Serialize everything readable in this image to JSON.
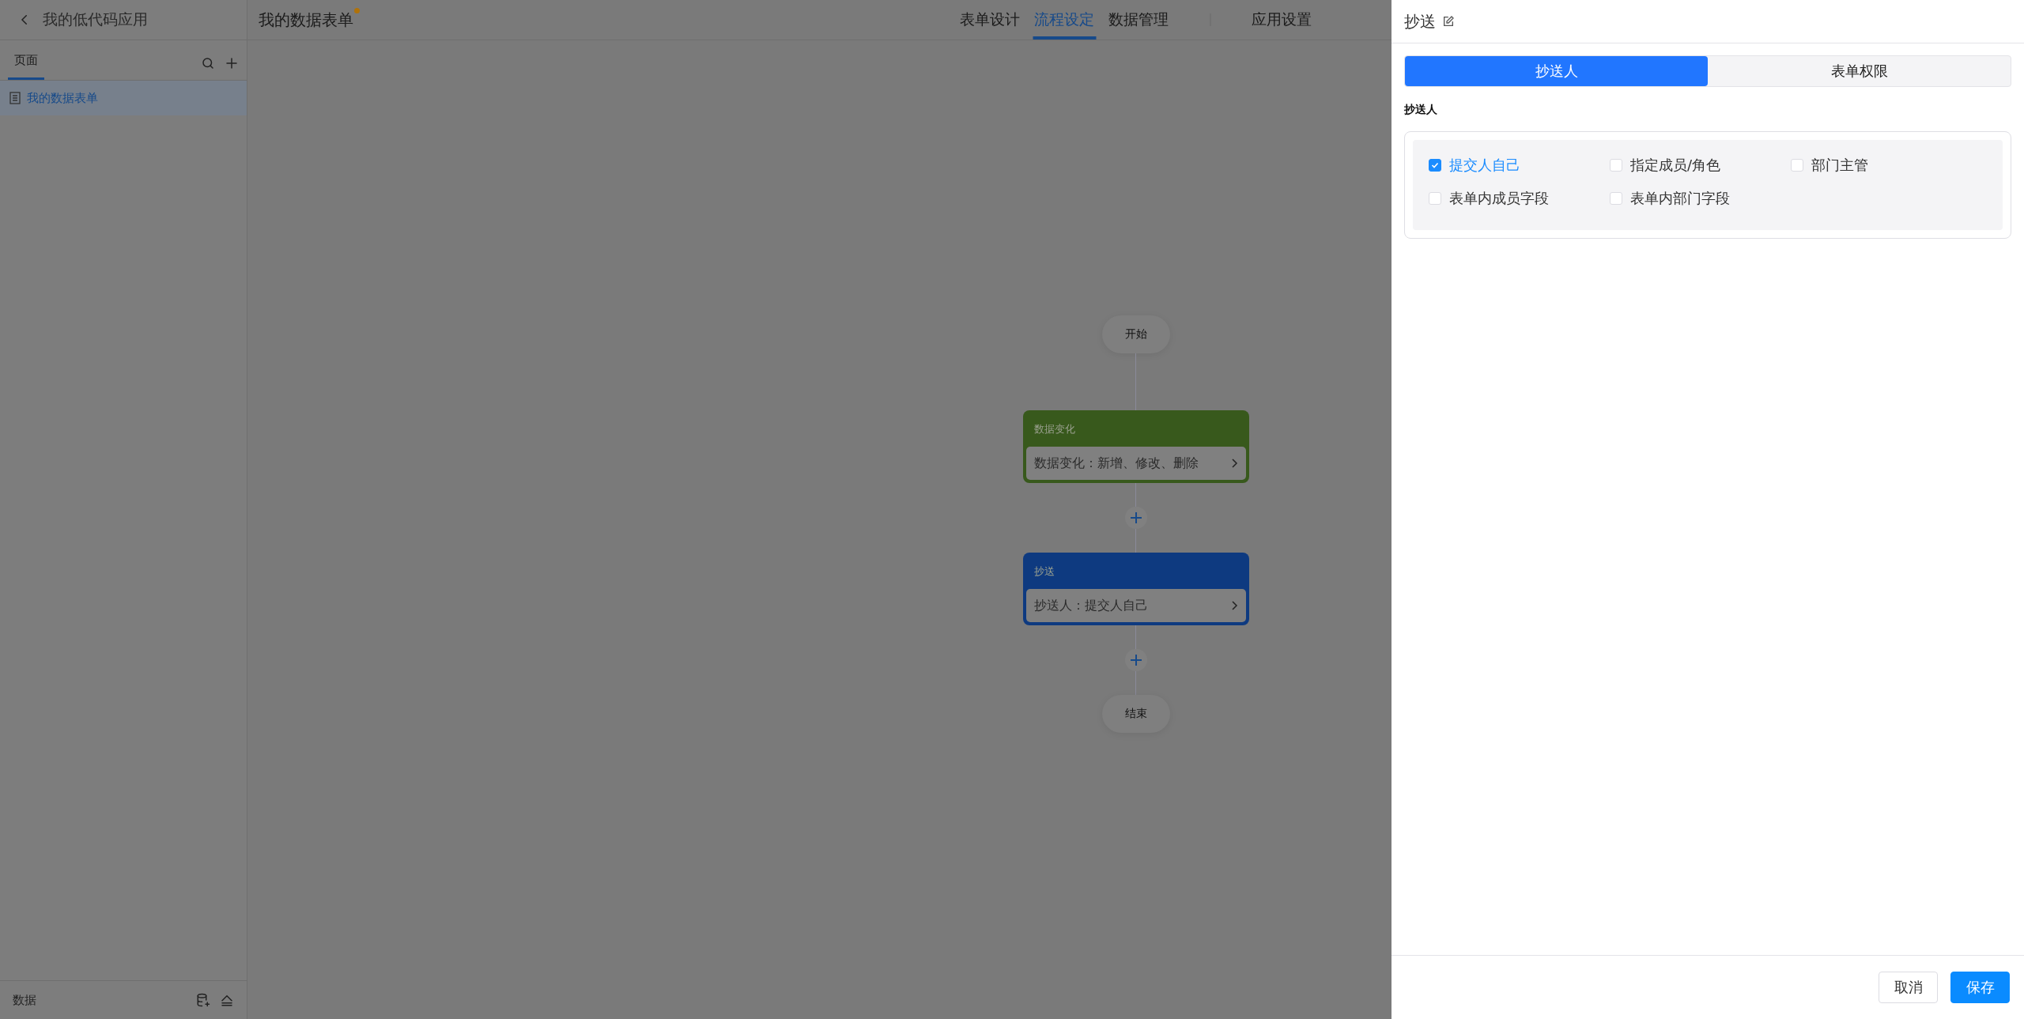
{
  "app": {
    "back_title": "我的低代码应用"
  },
  "sidebar": {
    "tabs": [
      {
        "label": "页面",
        "selected": true
      }
    ],
    "items": [
      {
        "label": "我的数据表单",
        "selected": true
      }
    ],
    "footer": {
      "label": "数据"
    }
  },
  "header": {
    "title": "我的数据表单",
    "unsaved": true,
    "tabs": [
      {
        "label": "表单设计",
        "selected": false
      },
      {
        "label": "流程设定",
        "selected": true
      },
      {
        "label": "数据管理",
        "selected": false
      }
    ],
    "settings": {
      "label": "应用设置",
      "selected": false
    }
  },
  "flow": {
    "nodes": [
      {
        "kind": "terminal",
        "label": "开始"
      },
      {
        "kind": "card",
        "title": "数据变化",
        "summary": "数据变化：新增、修改、删除",
        "color": "#38591c"
      },
      {
        "kind": "add"
      },
      {
        "kind": "card",
        "title": "抄送",
        "summary": "抄送人：提交人自己",
        "color": "#0e3a80"
      },
      {
        "kind": "add"
      },
      {
        "kind": "terminal",
        "label": "结束"
      }
    ]
  },
  "panel": {
    "title": "抄送",
    "tabs": [
      {
        "label": "抄送人",
        "selected": true
      },
      {
        "label": "表单权限",
        "selected": false
      }
    ],
    "section": "抄送人",
    "options": [
      {
        "label": "提交人自己",
        "checked": true
      },
      {
        "label": "指定成员/角色",
        "checked": false
      },
      {
        "label": "部门主管",
        "checked": false
      },
      {
        "label": "表单内成员字段",
        "checked": false
      },
      {
        "label": "表单内部门字段",
        "checked": false
      }
    ],
    "buttons": [
      {
        "label": "取消",
        "kind": "secondary"
      },
      {
        "label": "保存",
        "kind": "primary"
      }
    ]
  }
}
